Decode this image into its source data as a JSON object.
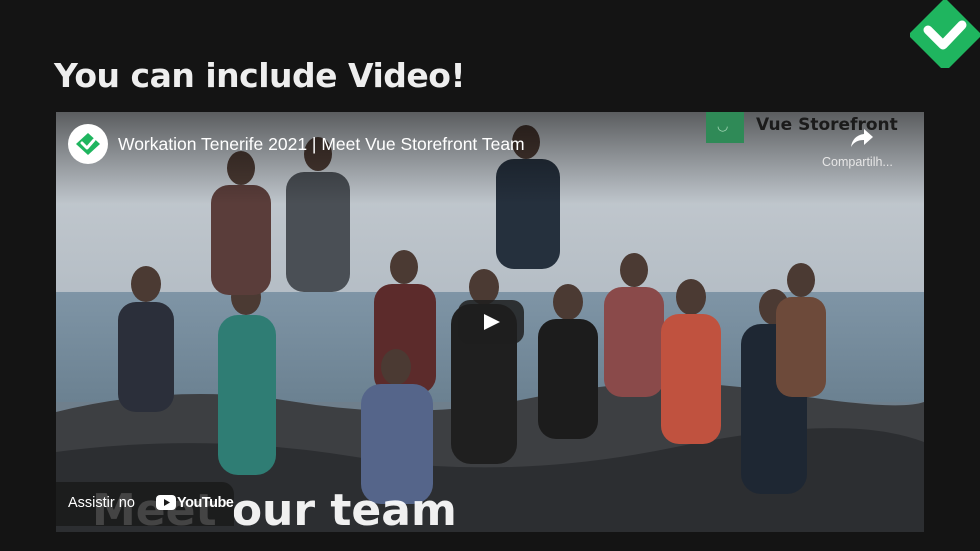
{
  "colors": {
    "background": "#141414",
    "brand_green": "#1fb55f",
    "title_text": "#eeeeee"
  },
  "corner_logo": {
    "icon": "check-chevron-logo-icon"
  },
  "slide": {
    "title": "You can include Video!"
  },
  "video": {
    "title": "Workation Tenerife 2021 | Meet Vue Storefront Team",
    "channel_icon": "vue-storefront-avatar-icon",
    "brand_text": "Vue Storefront",
    "share_label": "Compartilh...",
    "share_icon": "share-arrow-icon",
    "play_icon": "play-icon",
    "overlay_text": "Meet our team",
    "watch_on_label": "Assistir no",
    "youtube_wordmark": "YouTube"
  }
}
